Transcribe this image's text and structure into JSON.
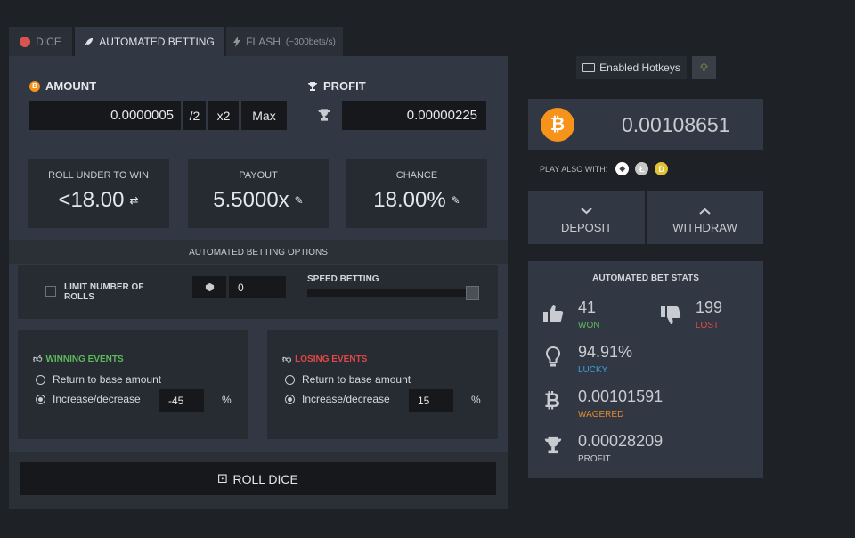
{
  "tabs": [
    {
      "label": "DICE"
    },
    {
      "label": "AUTOMATED BETTING"
    },
    {
      "label": "FLASH",
      "sub": "(~300bets/s)"
    }
  ],
  "amount": {
    "label": "AMOUNT",
    "value": "0.0000005",
    "half": "/2",
    "double": "x2",
    "max": "Max"
  },
  "profit": {
    "label": "PROFIT",
    "value": "0.00000225"
  },
  "roll": {
    "label": "ROLL UNDER TO WIN",
    "value": "<18.00"
  },
  "payout": {
    "label": "PAYOUT",
    "value": "5.5000x"
  },
  "chance": {
    "label": "CHANCE",
    "value": "18.00%"
  },
  "options_title": "AUTOMATED BETTING OPTIONS",
  "limit": {
    "label_line1": "LIMIT NUMBER OF",
    "label_line2": "ROLLS",
    "value": "0"
  },
  "speed": {
    "label": "SPEED BETTING",
    "level": 1.0
  },
  "winning": {
    "title": "WINNING EVENTS",
    "opt_return": "Return to base amount",
    "opt_increase": "Increase/decrease",
    "value": "-45",
    "unit": "%"
  },
  "losing": {
    "title": "LOSING EVENTS",
    "opt_return": "Return to base amount",
    "opt_increase": "Increase/decrease",
    "value": "15",
    "unit": "%"
  },
  "roll_button": "ROLL DICE",
  "hotkeys": "Enabled Hotkeys",
  "balance": "0.00108651",
  "play_also": "PLAY ALSO WITH:",
  "deposit": "DEPOSIT",
  "withdraw": "WITHDRAW",
  "stats": {
    "title": "AUTOMATED BET STATS",
    "won_value": "41",
    "won_label": "WON",
    "lost_value": "199",
    "lost_label": "LOST",
    "lucky_value": "94.91%",
    "lucky_label": "LUCKY",
    "wagered_value": "0.00101591",
    "wagered_label": "WAGERED",
    "profit_value": "0.00028209",
    "profit_label": "PROFIT"
  },
  "colors": {
    "bitcoin": "#f7931a",
    "won": "#5cb85c",
    "lost": "#e04848",
    "lucky": "#3a9fd6",
    "wagered": "#e08a2e",
    "winning_title": "#5cb85c",
    "losing_title": "#e04848"
  }
}
